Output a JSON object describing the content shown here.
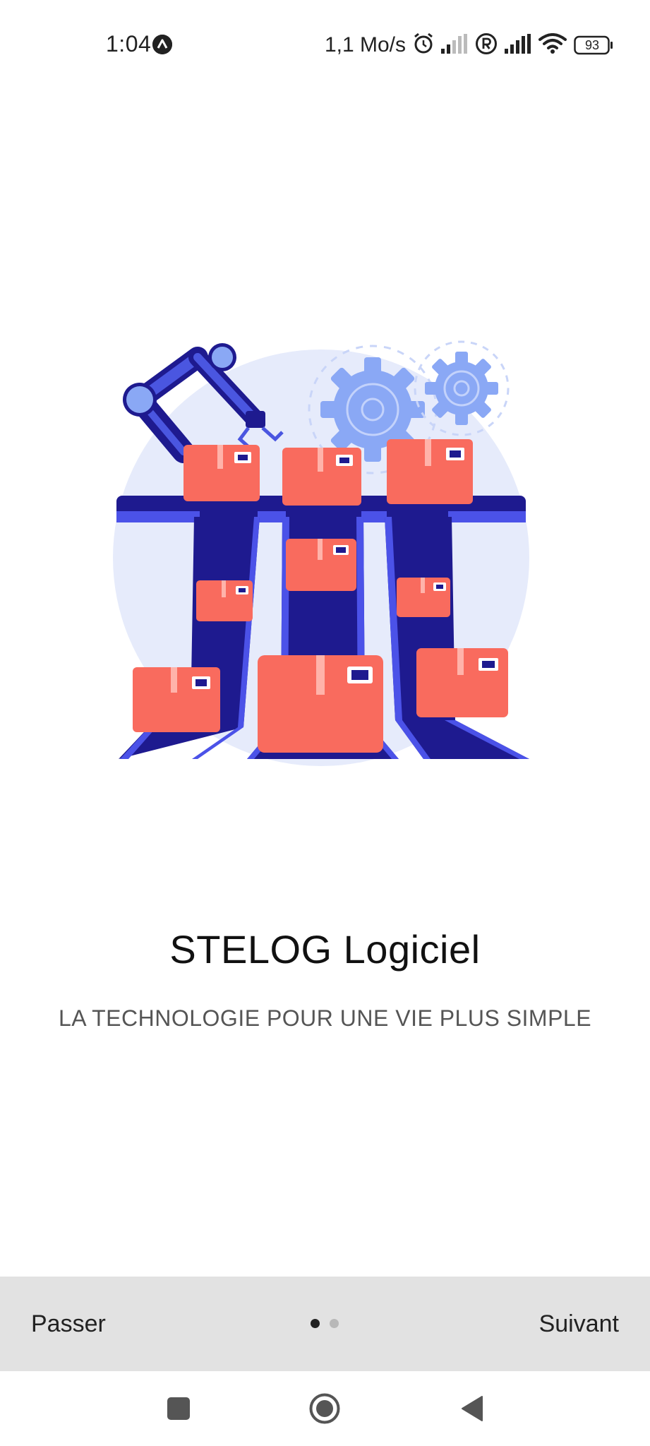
{
  "status_bar": {
    "time": "1:04",
    "network_speed": "1,1 Mo/s",
    "battery_level": "93",
    "icons": [
      "notification-a-icon",
      "alarm-icon",
      "signal-icon",
      "roaming-r-icon",
      "signal-icon",
      "wifi-icon",
      "battery-icon"
    ]
  },
  "illustration": {
    "name": "warehouse-conveyor-robot-arm-illustration",
    "colors": {
      "circle": "#e6ebfb",
      "conveyor": "#1e1a8f",
      "conveyor_edge": "#4b52e8",
      "box": "#f96b5e",
      "gear": "#8aa8f5",
      "arm": "#4a56e0"
    }
  },
  "onboarding": {
    "title": "STELOG Logiciel",
    "subtitle": "LA TECHNOLOGIE POUR UNE VIE PLUS SIMPLE",
    "skip_label": "Passer",
    "next_label": "Suivant",
    "current_page": 1,
    "total_pages": 2
  },
  "navigation_bar": {
    "buttons": [
      "recent-apps-icon",
      "home-icon",
      "back-icon"
    ]
  },
  "colors": {
    "background": "#ffffff",
    "bottom_bar": "#e2e2e2",
    "text_primary": "#111111",
    "text_secondary": "#555555"
  }
}
